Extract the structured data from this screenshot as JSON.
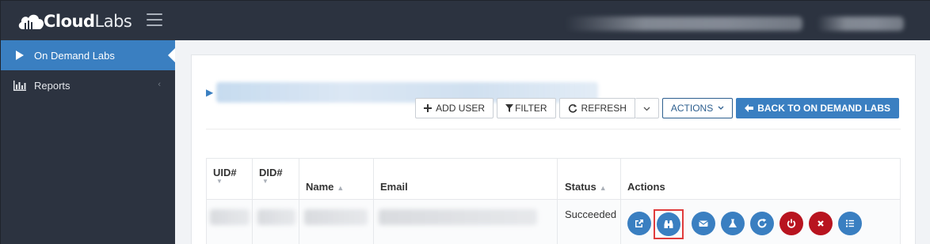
{
  "app": {
    "logo_bold": "Cloud",
    "logo_light": "Labs"
  },
  "header": {
    "user_menu_redacted": true
  },
  "sidebar": {
    "items": [
      {
        "label": "On Demand Labs",
        "icon": "play-icon",
        "active": true
      },
      {
        "label": "Reports",
        "icon": "bar-chart-icon",
        "active": false
      }
    ]
  },
  "toolbar": {
    "add_user_label": "ADD USER",
    "filter_label": "FILTER",
    "refresh_label": "REFRESH",
    "actions_label": "ACTIONS",
    "back_label": "BACK TO ON DEMAND LABS"
  },
  "table": {
    "columns": [
      {
        "label": "UID#",
        "sortable": true
      },
      {
        "label": "DID#",
        "sortable": true
      },
      {
        "label": "Name",
        "sortable": true
      },
      {
        "label": "Email",
        "sortable": false
      },
      {
        "label": "Status",
        "sortable": true
      },
      {
        "label": "Actions",
        "sortable": false
      }
    ],
    "rows": [
      {
        "status": "Succeeded"
      }
    ],
    "row_actions": [
      {
        "icon": "external-link-icon",
        "color": "#3a7fc1"
      },
      {
        "icon": "binoculars-icon",
        "color": "#3a7fc1",
        "highlighted": true
      },
      {
        "icon": "envelope-icon",
        "color": "#3a7fc1"
      },
      {
        "icon": "flask-icon",
        "color": "#3a7fc1"
      },
      {
        "icon": "refresh-icon",
        "color": "#3a7fc1"
      },
      {
        "icon": "power-icon",
        "color": "#b8141f"
      },
      {
        "icon": "close-icon",
        "color": "#b8141f"
      },
      {
        "icon": "list-icon",
        "color": "#3a7fc1"
      }
    ]
  },
  "colors": {
    "nav_bg": "#2c3340",
    "accent": "#3a7fc1",
    "danger": "#b8141f",
    "highlight_box": "#e03c3c"
  }
}
